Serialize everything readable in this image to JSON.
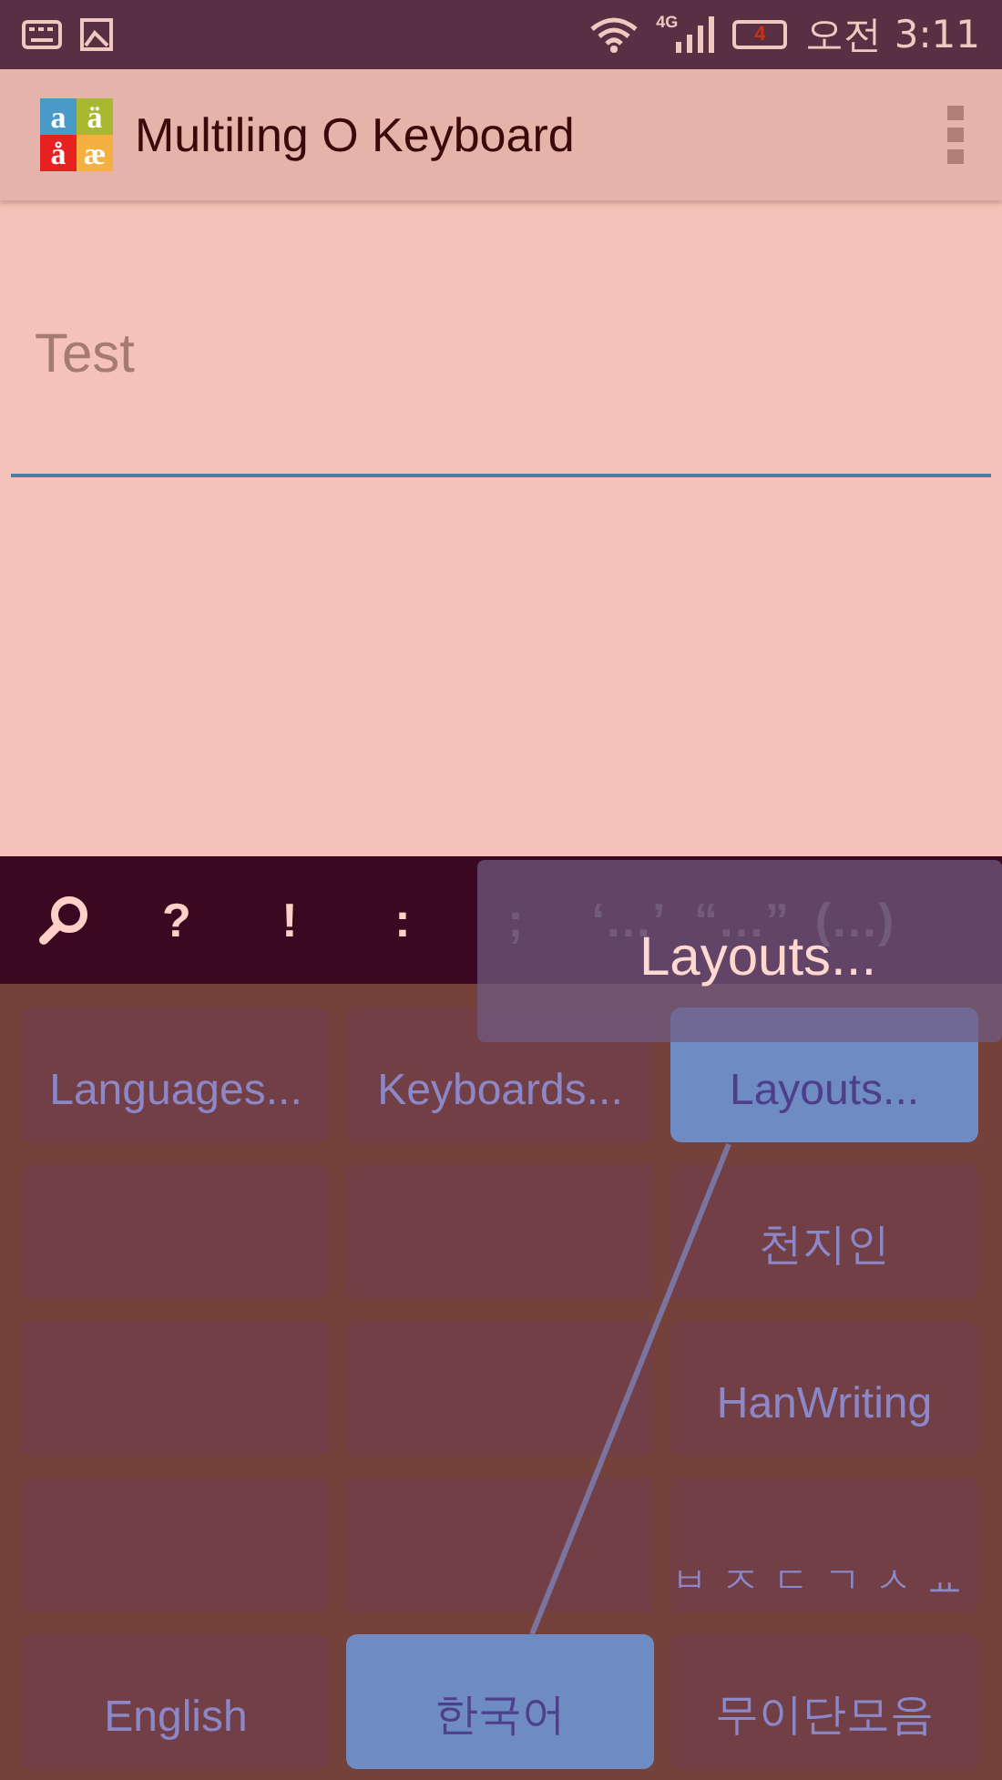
{
  "status_bar": {
    "time": "오전 3:11",
    "network": "4G",
    "battery": "4"
  },
  "app_bar": {
    "title": "Multiling O Keyboard",
    "logo_letters": [
      "a",
      "ä",
      "å",
      "æ"
    ]
  },
  "text_field": {
    "placeholder": "Test"
  },
  "suggestion_strip": {
    "items": [
      {
        "kind": "search"
      },
      {
        "kind": "char",
        "label": "?"
      },
      {
        "kind": "char",
        "label": "!"
      },
      {
        "kind": "char",
        "label": ":"
      },
      {
        "kind": "char",
        "label": ";"
      },
      {
        "kind": "char",
        "label": "‘…’"
      },
      {
        "kind": "char",
        "label": "“…”"
      },
      {
        "kind": "char",
        "label": "(…)"
      }
    ]
  },
  "popup": {
    "label": "Layouts..."
  },
  "keys": [
    {
      "label": "Languages...",
      "selected": false
    },
    {
      "label": "Keyboards...",
      "selected": false
    },
    {
      "label": "Layouts...",
      "selected": true
    },
    {
      "selected": false
    },
    {
      "selected": false
    },
    {
      "label": "천지인",
      "selected": false
    },
    {
      "selected": false
    },
    {
      "selected": false
    },
    {
      "label": "HanWriting",
      "selected": false
    },
    {
      "selected": false
    },
    {
      "selected": false
    },
    {
      "label": "ㅂㅈㄷㄱㅅㅛ",
      "selected": false
    },
    {
      "label": "English",
      "selected": false
    },
    {
      "label": "한국어",
      "selected": true
    },
    {
      "label": "무이단모음",
      "selected": false
    }
  ]
}
